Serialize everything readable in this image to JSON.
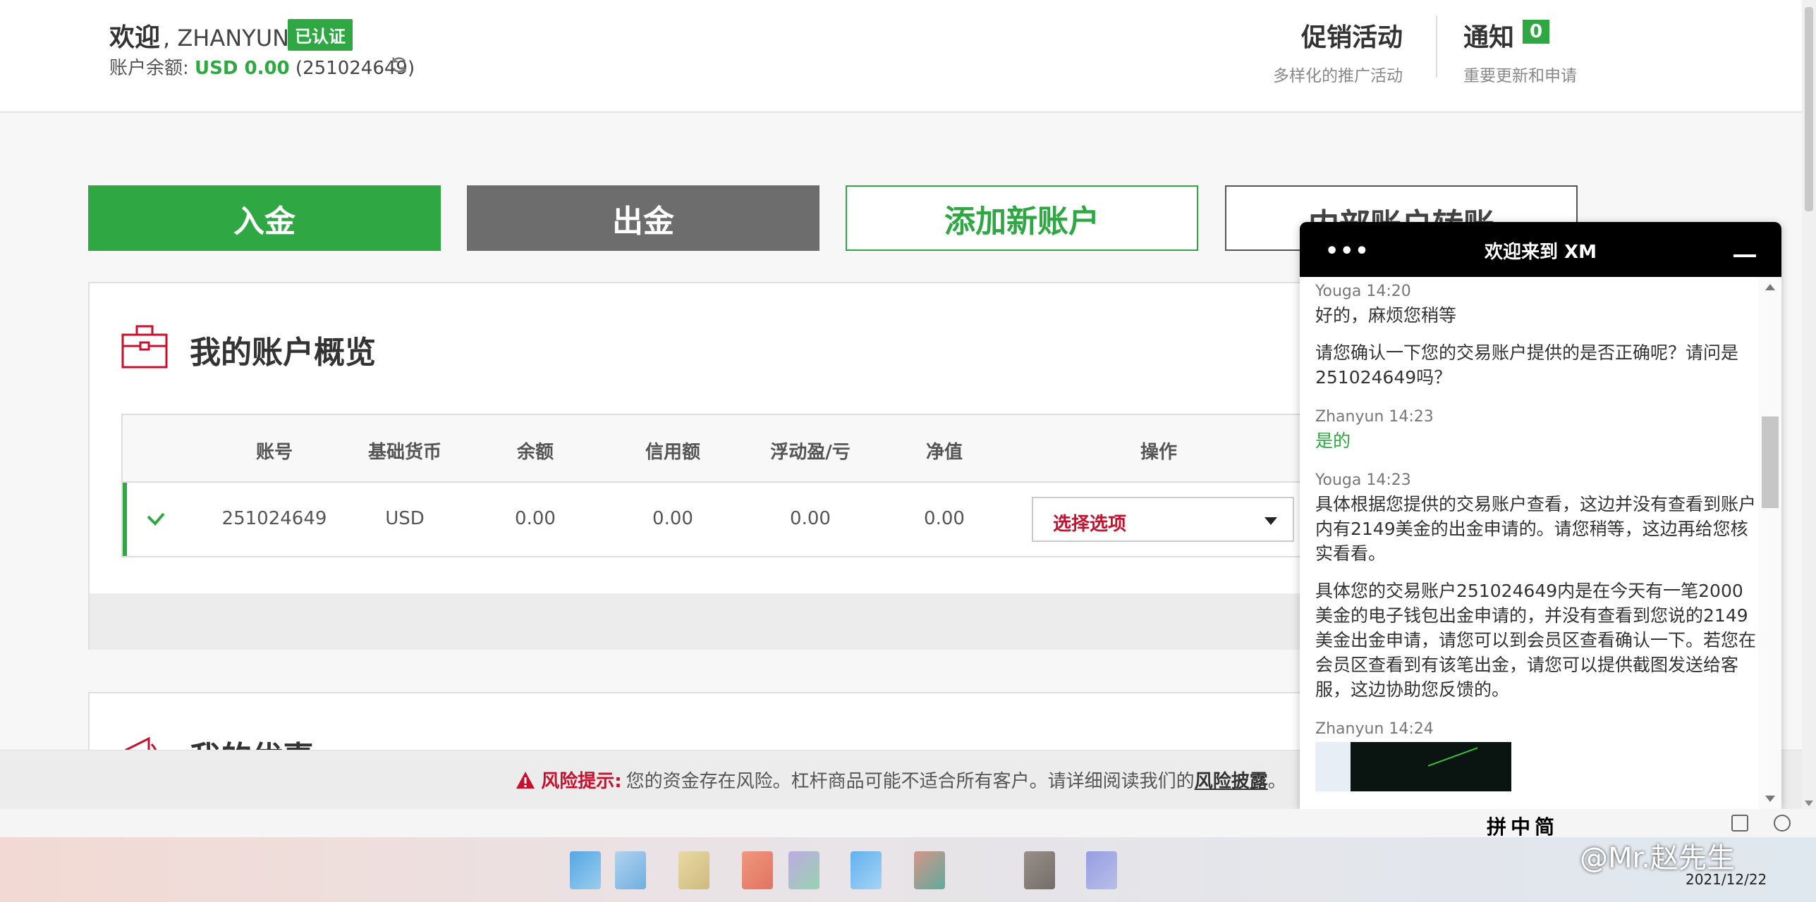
{
  "header": {
    "welcome": "欢迎",
    "username": ", ZHANYUN",
    "verified_badge": "已认证",
    "balance_label": "账户余额: ",
    "balance_amount": "USD 0.00",
    "account_number": " (251024649)",
    "promo_title": "促销活动",
    "promo_subtitle": "多样化的推广活动",
    "notify_title": "通知",
    "notify_count": "0",
    "notify_subtitle": "重要更新和申请"
  },
  "actions": {
    "deposit": "入金",
    "withdraw": "出金",
    "add_account": "添加新账户",
    "internal_transfer": "内部账户转账"
  },
  "overview": {
    "title": "我的账户概览",
    "columns": [
      "账号",
      "基础货币",
      "余额",
      "信用额",
      "浮动盈/亏",
      "净值",
      "操作"
    ],
    "row": {
      "account": "251024649",
      "currency": "USD",
      "balance": "0.00",
      "credit": "0.00",
      "floating_pl": "0.00",
      "equity": "0.00",
      "action_select": "选择选项"
    }
  },
  "offers": {
    "title": "我的优惠"
  },
  "risk": {
    "label": "风险提示:",
    "text": " 您的资金存在风险。杠杆商品可能不适合所有客户。请详细阅读我们的",
    "link": "风险披露",
    "end": "。"
  },
  "chat": {
    "menu": "•••",
    "title": "欢迎来到 XM",
    "messages": [
      {
        "author": "Youga 14:20",
        "text": "好的，麻烦您稍等"
      },
      {
        "author": "",
        "text": "请您确认一下您的交易账户提供的是否正确呢？请问是251024649吗？"
      },
      {
        "author": "Zhanyun 14:23",
        "text": "是的"
      },
      {
        "author": "Youga 14:23",
        "text": "具体根据您提供的交易账户查看，这边并没有查看到账户内有2149美金的出金申请的。请您稍等，这边再给您核实看看。"
      },
      {
        "author": "",
        "text": "具体您的交易账户251024649内是在今天有一笔2000美金的电子钱包出金申请的，并没有查看到您说的2149美金出金申请，请您可以到会员区查看确认一下。若您在会员区查看到有该笔出金，请您可以提供截图发送给客服，这边协助您反馈的。"
      },
      {
        "author": "Zhanyun 14:24",
        "text": ""
      }
    ]
  },
  "ime": {
    "indicators": "拼中简"
  },
  "taskbar": {
    "date": "2021/12/22",
    "watermark": "@Mr.赵先生"
  },
  "colors": {
    "brand_green": "#2fa843",
    "danger_red": "#c8102e",
    "withdraw_gray": "#6d6d6d"
  }
}
